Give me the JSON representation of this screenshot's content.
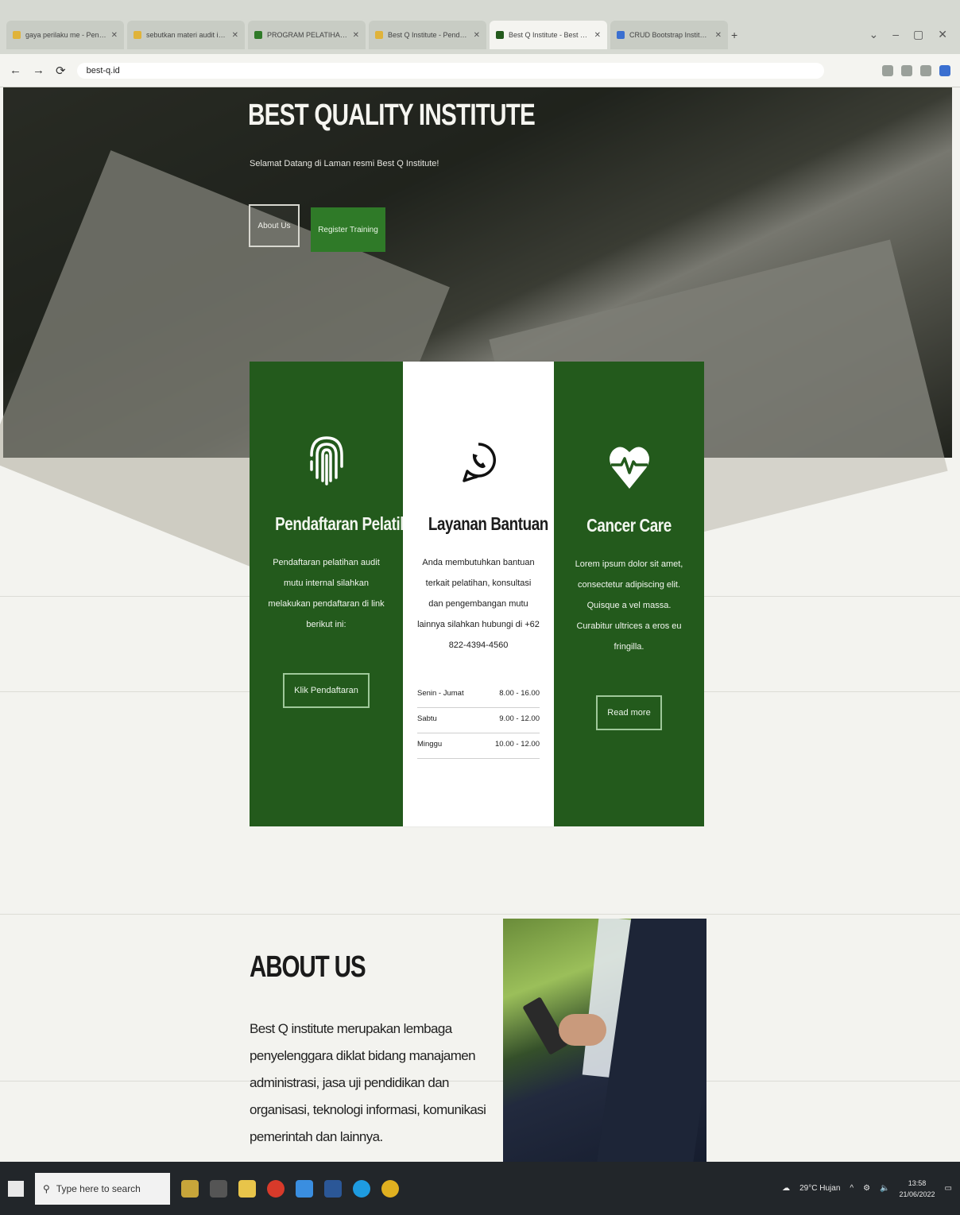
{
  "browser": {
    "tabs": [
      {
        "label": "gaya perilaku me - Penca..."
      },
      {
        "label": "sebutkan materi audit inte..."
      },
      {
        "label": "PROGRAM PELATIHAN A..."
      },
      {
        "label": "Best Q Institute - Pendaftar..."
      },
      {
        "label": "Best Q Institute - Best Q In...",
        "active": true
      },
      {
        "label": "CRUD Bootstrap Institute..."
      }
    ],
    "url": "best-q.id",
    "window_controls": [
      "⌄",
      "–",
      "▢",
      "✕"
    ]
  },
  "hero": {
    "title": "BEST QUALITY INSTITUTE",
    "subtitle": "Selamat Datang di Laman resmi Best Q Institute!",
    "about_button": "About Us",
    "register_button": "Register Training"
  },
  "cards": {
    "registration": {
      "title": "Pendaftaran Pelatihan",
      "text": "Pendaftaran pelatihan audit mutu internal silahkan melakukan pendaftaran di link berikut ini:",
      "button": "Klik Pendaftaran",
      "icon": "fingerprint-icon"
    },
    "support": {
      "title": "Layanan Bantuan",
      "text": "Anda membutuhkan bantuan terkait pelatihan, konsultasi dan pengembangan mutu lainnya silahkan hubungi di +62 822-4394-4560",
      "icon": "whatsapp-icon",
      "hours": [
        {
          "day": "Senin - Jumat",
          "time": "8.00 - 16.00"
        },
        {
          "day": "Sabtu",
          "time": "9.00 - 12.00"
        },
        {
          "day": "Minggu",
          "time": "10.00 - 12.00"
        }
      ]
    },
    "cancer": {
      "title": "Cancer Care",
      "text": "Lorem ipsum dolor sit amet, consectetur adipiscing elit. Quisque a vel massa. Curabitur ultrices a eros eu fringilla.",
      "button": "Read more",
      "icon": "heart-pulse-icon"
    }
  },
  "about": {
    "title": "ABOUT US",
    "text": "Best Q institute merupakan lembaga penyelenggara diklat bidang manajamen administrasi, jasa uji pendidikan dan organisasi, teknologi informasi, komunikasi pemerintah dan lainnya."
  },
  "taskbar": {
    "search_placeholder": "Type here to search",
    "weather": "29°C Hujan",
    "time": "13:58",
    "date": "21/06/2022"
  },
  "colors": {
    "brand_green": "#235a1c",
    "button_green": "#2f7a28"
  }
}
